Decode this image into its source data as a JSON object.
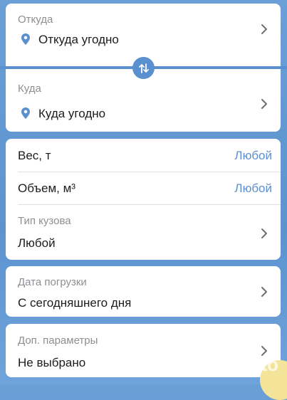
{
  "route": {
    "from": {
      "label": "Откуда",
      "value": "Откуда угодно"
    },
    "to": {
      "label": "Куда",
      "value": "Куда угодно"
    }
  },
  "params": {
    "weight": {
      "label": "Вес, т",
      "value": "Любой"
    },
    "volume": {
      "label": "Объем, м³",
      "value": "Любой"
    },
    "body_type": {
      "label": "Тип кузова",
      "value": "Любой"
    }
  },
  "loading_date": {
    "label": "Дата погрузки",
    "value": "С сегодняшнего дня"
  },
  "extra": {
    "label": "Доп. параметры",
    "value": "Не выбрано"
  },
  "watermark": {
    "text": "Avito"
  },
  "colors": {
    "accent": "#5a8fd0",
    "link": "#5b8fcf",
    "background": "#6b9fd6"
  }
}
